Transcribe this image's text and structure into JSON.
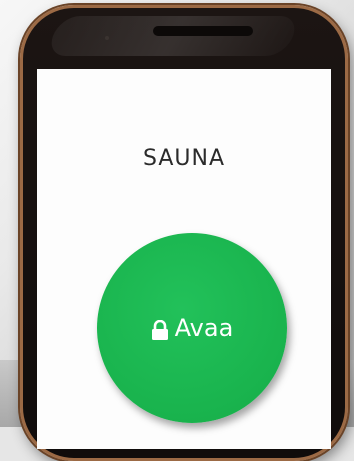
{
  "screen": {
    "title": "SAUNA",
    "open_button": {
      "label": "Avaa",
      "icon": "lock-icon",
      "color": "#1db954"
    }
  },
  "colors": {
    "phone_body": "#151110",
    "phone_frame": "#9c6a45",
    "screen_background": "#fdfdfd"
  }
}
